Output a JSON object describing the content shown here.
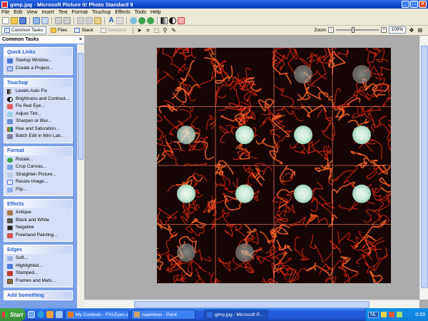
{
  "window": {
    "title": "gimp.jpg - Microsoft Picture It! Photo Standard 9"
  },
  "menu": [
    "File",
    "Edit",
    "View",
    "Insert",
    "Text",
    "Format",
    "Touchup",
    "Effects",
    "Tools",
    "Help"
  ],
  "viewbar": {
    "common_tasks": "Common Tasks",
    "files": "Files",
    "stack": "Stack",
    "selection": "Selection",
    "zoom_label": "Zoom",
    "zoom_value": "109%"
  },
  "taskpane": {
    "header": "Common Tasks",
    "close": "×",
    "panels": [
      {
        "title": "Quick Links",
        "items": [
          "Startup Window...",
          "Create a Project..."
        ]
      },
      {
        "title": "Touchup",
        "items": [
          "Levels Auto Fix",
          "Brightness and Contrast...",
          "Fix Red Eye...",
          "Adjust Tint...",
          "Sharpen or Blur...",
          "Hue and Saturation...",
          "Batch Edit in Mini Lab..."
        ]
      },
      {
        "title": "Format",
        "items": [
          "Rotate...",
          "Crop Canvas...",
          "Straighten Picture...",
          "Resize Image...",
          "Flip..."
        ]
      },
      {
        "title": "Effects",
        "items": [
          "Antique",
          "Black and White",
          "Negative",
          "Freehand Painting..."
        ]
      },
      {
        "title": "Edges",
        "items": [
          "Soft...",
          "Highlighted...",
          "Stamped...",
          "Frames and Mats..."
        ]
      },
      {
        "title": "Add Something",
        "items": []
      }
    ]
  },
  "taskbar": {
    "start": "Start",
    "buttons": [
      {
        "label": "My Contests - PXLEyes.c...",
        "icon_color": "#e67e22",
        "active": false
      },
      {
        "label": "naamloos - Paint",
        "icon_color": "#c8a26a",
        "active": false
      },
      {
        "label": "gimp.jpg - Microsoft P...",
        "icon_color": "#2d6cdf",
        "active": true
      }
    ],
    "tray_lang": "NL",
    "clock": "0:59"
  },
  "image": {
    "grid": {
      "cols": 4,
      "rows": 4
    },
    "orb_tiles": [
      [
        0,
        2
      ],
      [
        0,
        3
      ],
      [
        1,
        0
      ],
      [
        1,
        1
      ],
      [
        1,
        2
      ],
      [
        1,
        3
      ],
      [
        2,
        0
      ],
      [
        2,
        1
      ],
      [
        2,
        2
      ],
      [
        2,
        3
      ],
      [
        3,
        0
      ],
      [
        3,
        1
      ]
    ],
    "colors": {
      "background": "#170404",
      "vein": "#d92a12",
      "vein_bright": "#ff6a2a",
      "orb": "#d6f7e6",
      "grid_line": "#d9714f"
    }
  }
}
